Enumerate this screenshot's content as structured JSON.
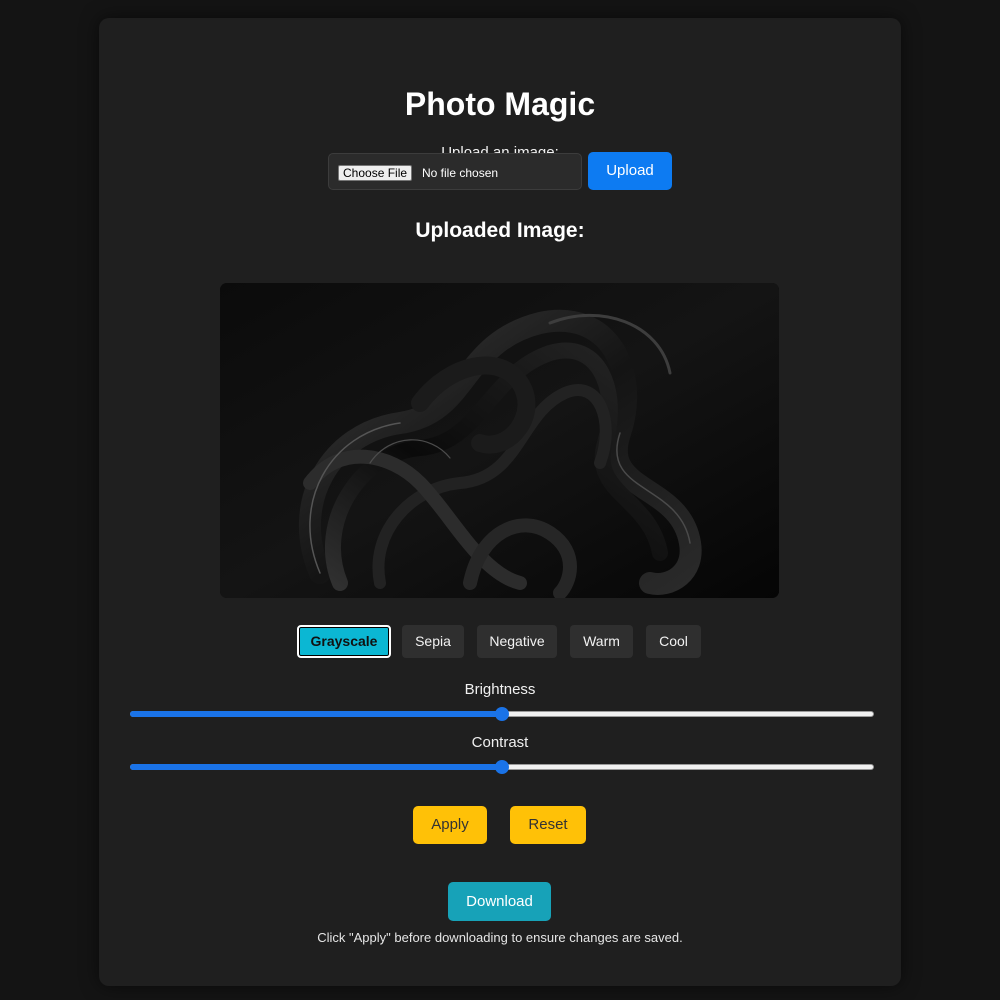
{
  "app": {
    "title": "Photo Magic"
  },
  "upload": {
    "label": "Upload an image:",
    "choose_file_label": "Choose File",
    "file_status": "No file chosen",
    "upload_button": "Upload"
  },
  "preview": {
    "heading": "Uploaded Image:"
  },
  "filters": [
    {
      "label": "Grayscale",
      "active": true
    },
    {
      "label": "Sepia",
      "active": false
    },
    {
      "label": "Negative",
      "active": false
    },
    {
      "label": "Warm",
      "active": false
    },
    {
      "label": "Cool",
      "active": false
    }
  ],
  "adjustments": {
    "brightness": {
      "label": "Brightness",
      "value_fraction": 0.5
    },
    "contrast": {
      "label": "Contrast",
      "value_fraction": 0.5
    }
  },
  "actions": {
    "apply": "Apply",
    "reset": "Reset",
    "download": "Download",
    "note": "Click \"Apply\" before downloading to ensure changes are saved."
  },
  "colors": {
    "page_bg": "#141414",
    "card_bg": "#1f1f1f",
    "upload_button": "#0d7bf2",
    "active_filter": "#0bb7d3",
    "action_button": "#ffc107",
    "download_button": "#17a2b8",
    "slider_fill": "#1a73e8"
  }
}
